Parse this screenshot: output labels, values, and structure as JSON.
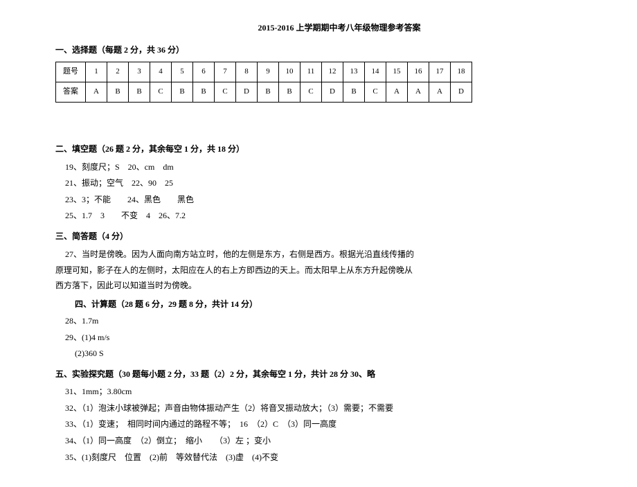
{
  "title": "2015-2016 上学期期中考八年级物理参考答案",
  "section1": {
    "header": "一、选择题（每题 2 分，共 36 分）",
    "row_label_num": "题号",
    "row_label_ans": "答案",
    "nums": [
      "1",
      "2",
      "3",
      "4",
      "5",
      "6",
      "7",
      "8",
      "9",
      "10",
      "11",
      "12",
      "13",
      "14",
      "15",
      "16",
      "17",
      "18"
    ],
    "answers": [
      "A",
      "B",
      "B",
      "C",
      "B",
      "B",
      "C",
      "D",
      "B",
      "B",
      "C",
      "D",
      "B",
      "C",
      "A",
      "A",
      "A",
      "D"
    ]
  },
  "section2": {
    "header": "二、填空题（26 题 2 分，其余每空 1 分，共 18 分）",
    "lines": [
      "19、刻度尺；S　20、cm　dm",
      "21、振动；空气　22、90　25",
      "23、3；不能　　24、黑色　　黑色",
      "25、1.7　3　　不变　4　26、7.2"
    ]
  },
  "section3": {
    "header": "三、简答题（4 分）",
    "lines": [
      "27、当时是傍晚。因为人面向南方站立时，他的左侧是东方，右侧是西方。根据光沿直线传播的",
      "原理可知，影子在人的左侧时，太阳应在人的右上方即西边的天上。而太阳早上从东方升起傍晚从",
      "西方落下，因此可以知道当时为傍晚。"
    ]
  },
  "section4": {
    "header": "四、计算题（28 题 6 分，29 题 8 分，共计 14 分）",
    "lines": [
      "28、1.7m",
      "29、(1)4 m/s"
    ],
    "sub": "(2)360 S"
  },
  "section5": {
    "header": "五、实验探究题（30 题每小题 2 分，33 题（2）2 分，其余每空 1 分，共计 28 分 30、略",
    "lines": [
      "31、1mm；3.80cm",
      "32、（1）泡沫小球被弹起；声音由物体振动产生（2）将音叉振动放大；（3）需要；不需要",
      "33、（1）变速；　相同时间内通过的路程不等；　16　（2）C　（3）同一高度",
      "34、（1）同一高度　（2）倒立；　缩小　　（3）左 ；变小",
      "35、(1)刻度尺　位置　(2)前　等效替代法　(3)虚　(4)不变"
    ]
  }
}
